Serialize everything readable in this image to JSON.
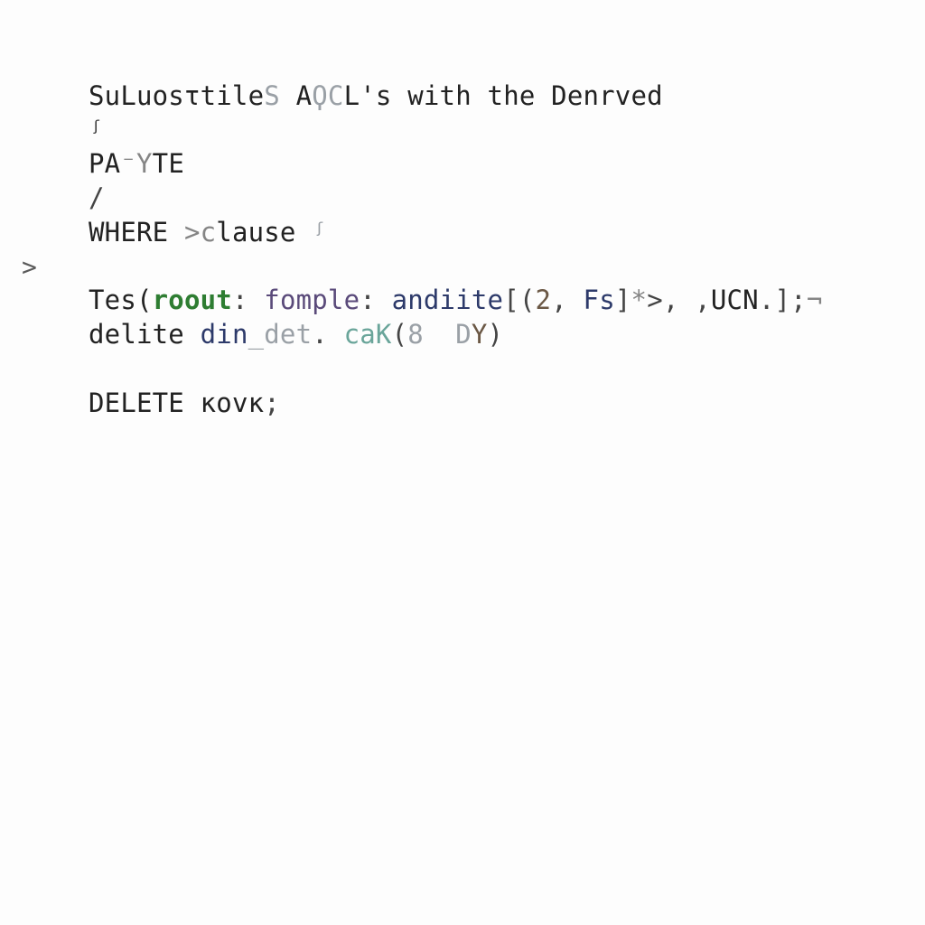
{
  "gutter": {
    "prompt": ">"
  },
  "code": {
    "l1": {
      "a": "SuLuosτtile",
      "b": "S",
      "c": " A",
      "d": "ϘϹ",
      "e": "L's with the Denrved"
    },
    "l2": {
      "a": "ᶴ"
    },
    "l3": {
      "a": "PA",
      "b": "⁻Y",
      "c": "TE"
    },
    "l4": {
      "a": "/"
    },
    "l5": {
      "a": "WHERE ",
      "b": ">c",
      "c": "lause ",
      "d": "ᶴ"
    },
    "l6": {
      "a": "Tes(",
      "b": "roout",
      "c": ": ",
      "d": "fomple",
      "e": ": ",
      "f": "andiite",
      "g": "[(",
      "h": "2",
      "i": ", ",
      "j": "Fs",
      "k": "]",
      "l": "*",
      "m": ">, ,",
      "n": "UCN",
      "o": ".];",
      "p": "¬"
    },
    "l7": {
      "a": "delite ",
      "b": "din",
      "c": "_det",
      "d": ". ",
      "e": "caK",
      "f": "(",
      "g": "8  D",
      "h": "Y",
      "i": ")"
    },
    "l8": {
      "a": "DELETE ",
      "b": "ĸovĸ",
      "c": ";"
    }
  }
}
